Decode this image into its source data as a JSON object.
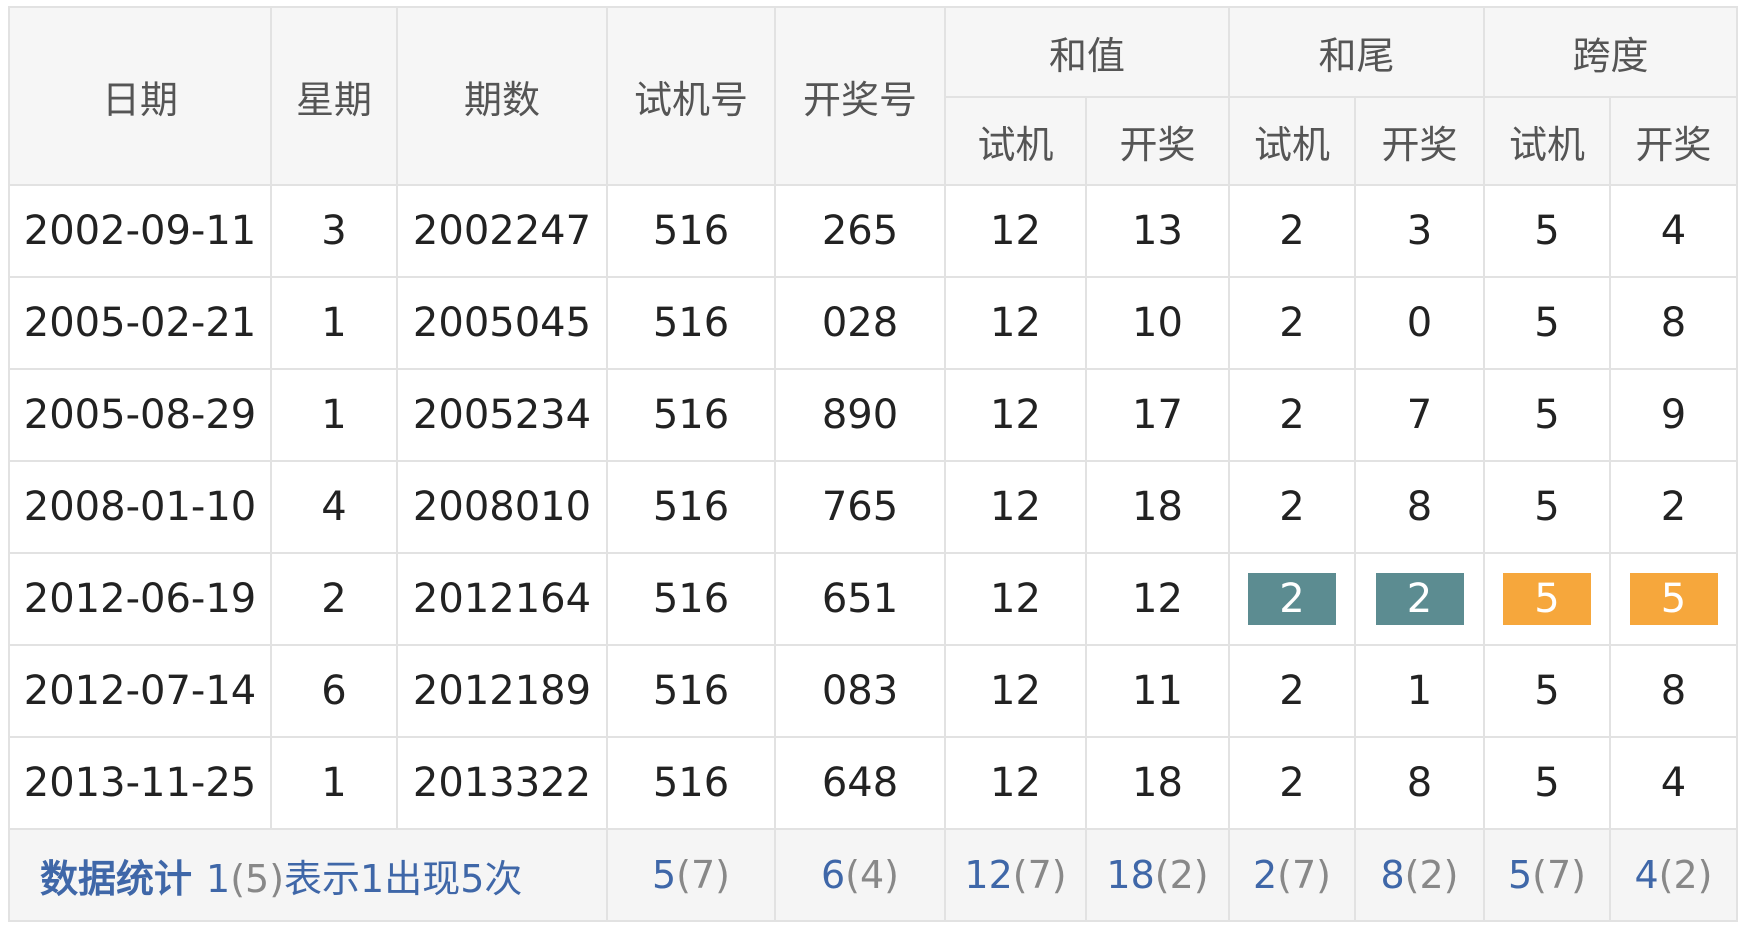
{
  "headers": {
    "date": "日期",
    "weekday": "星期",
    "period": "期数",
    "test_number": "试机号",
    "draw_number": "开奖号",
    "sum": "和值",
    "sum_tail": "和尾",
    "span": "跨度",
    "sub_test": "试机",
    "sub_draw": "开奖"
  },
  "rows": [
    {
      "date": "2002-09-11",
      "weekday": "3",
      "period": "2002247",
      "test": "516",
      "draw": "265",
      "sum_test": "12",
      "sum_draw": "13",
      "tail_test": "2",
      "tail_draw": "3",
      "span_test": "5",
      "span_draw": "4"
    },
    {
      "date": "2005-02-21",
      "weekday": "1",
      "period": "2005045",
      "test": "516",
      "draw": "028",
      "sum_test": "12",
      "sum_draw": "10",
      "tail_test": "2",
      "tail_draw": "0",
      "span_test": "5",
      "span_draw": "8"
    },
    {
      "date": "2005-08-29",
      "weekday": "1",
      "period": "2005234",
      "test": "516",
      "draw": "890",
      "sum_test": "12",
      "sum_draw": "17",
      "tail_test": "2",
      "tail_draw": "7",
      "span_test": "5",
      "span_draw": "9"
    },
    {
      "date": "2008-01-10",
      "weekday": "4",
      "period": "2008010",
      "test": "516",
      "draw": "765",
      "sum_test": "12",
      "sum_draw": "18",
      "tail_test": "2",
      "tail_draw": "8",
      "span_test": "5",
      "span_draw": "2"
    },
    {
      "date": "2012-06-19",
      "weekday": "2",
      "period": "2012164",
      "test": "516",
      "draw": "651",
      "sum_test": "12",
      "sum_draw": "12",
      "tail_test": "2",
      "tail_draw": "2",
      "span_test": "5",
      "span_draw": "5"
    },
    {
      "date": "2012-07-14",
      "weekday": "6",
      "period": "2012189",
      "test": "516",
      "draw": "083",
      "sum_test": "12",
      "sum_draw": "11",
      "tail_test": "2",
      "tail_draw": "1",
      "span_test": "5",
      "span_draw": "8"
    },
    {
      "date": "2013-11-25",
      "weekday": "1",
      "period": "2013322",
      "test": "516",
      "draw": "648",
      "sum_test": "12",
      "sum_draw": "18",
      "tail_test": "2",
      "tail_draw": "8",
      "span_test": "5",
      "span_draw": "4"
    }
  ],
  "stats": {
    "label": "数据统计",
    "desc_value": "1",
    "desc_count": "(5)",
    "desc_text": "表示1出现5次",
    "test": {
      "v": "5",
      "c": "(7)"
    },
    "draw": {
      "v": "6",
      "c": "(4)"
    },
    "sum_test": {
      "v": "12",
      "c": "(7)"
    },
    "sum_draw": {
      "v": "18",
      "c": "(2)"
    },
    "tail_test": {
      "v": "2",
      "c": "(7)"
    },
    "tail_draw": {
      "v": "8",
      "c": "(2)"
    },
    "span_test": {
      "v": "5",
      "c": "(7)"
    },
    "span_draw": {
      "v": "4",
      "c": "(2)"
    }
  },
  "colors": {
    "draw_red": "#c0282e",
    "tail_highlight": "#5c8c91",
    "span_highlight": "#f6a73c",
    "stats_blue": "#3f67a8"
  }
}
